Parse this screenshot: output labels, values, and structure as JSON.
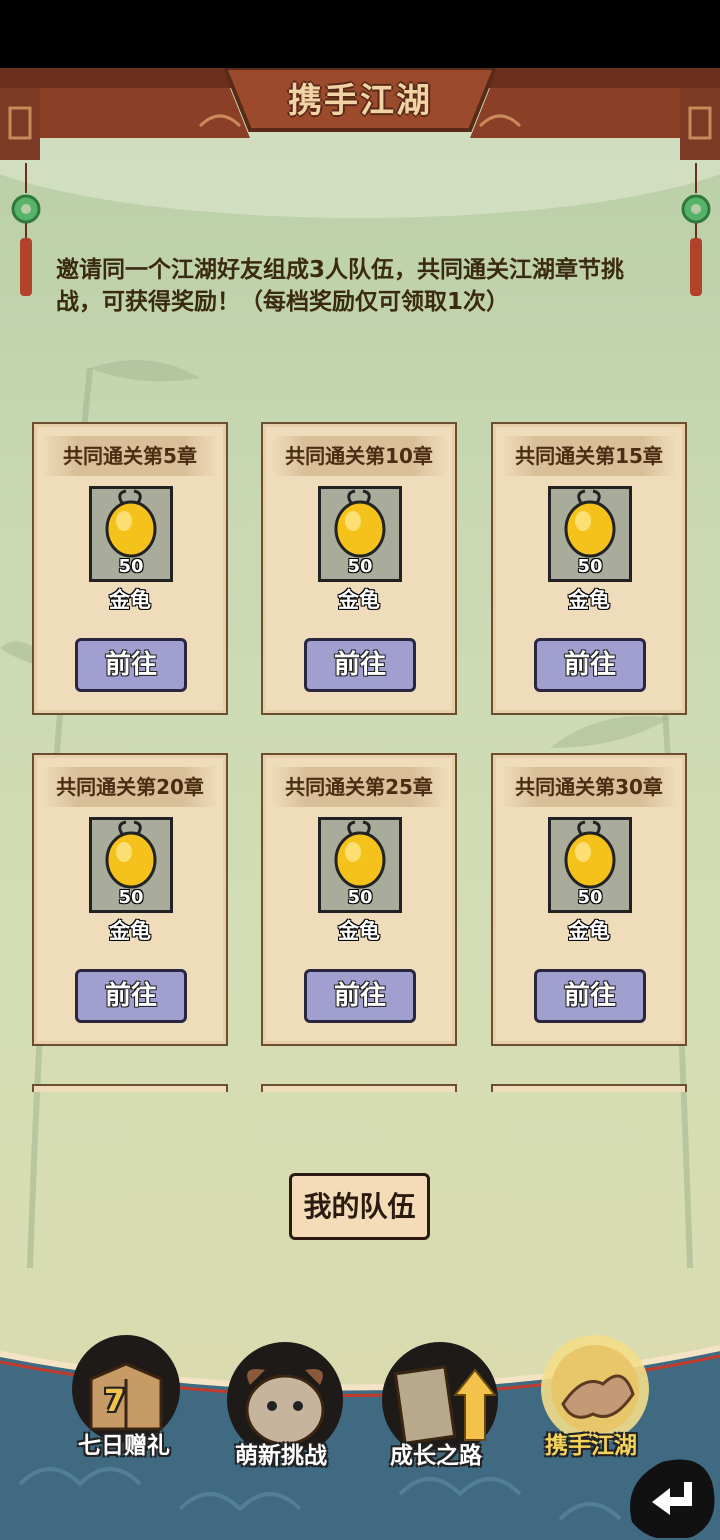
{
  "header": {
    "title": "携手江湖"
  },
  "description": "邀请同一个江湖好友组成3人队伍，共同通关江湖章节挑战，可获得奖励！（每档奖励仅可领取1次）",
  "rewards": [
    {
      "title": "共同通关第5章",
      "item": "金龟",
      "qty": "50",
      "button": "前往"
    },
    {
      "title": "共同通关第10章",
      "item": "金龟",
      "qty": "50",
      "button": "前往"
    },
    {
      "title": "共同通关第15章",
      "item": "金龟",
      "qty": "50",
      "button": "前往"
    },
    {
      "title": "共同通关第20章",
      "item": "金龟",
      "qty": "50",
      "button": "前往"
    },
    {
      "title": "共同通关第25章",
      "item": "金龟",
      "qty": "50",
      "button": "前往"
    },
    {
      "title": "共同通关第30章",
      "item": "金龟",
      "qty": "50",
      "button": "前往"
    }
  ],
  "team_button": "我的队伍",
  "tabs": [
    {
      "label": "七日赠礼",
      "badge": "7",
      "icon": "gift-box-icon"
    },
    {
      "label": "萌新挑战",
      "icon": "pig-face-icon"
    },
    {
      "label": "成长之路",
      "icon": "book-arrow-icon"
    },
    {
      "label": "携手江湖",
      "icon": "handshake-icon",
      "active": true
    }
  ],
  "colors": {
    "button_purple": "#a19ed0",
    "card_bg": "#efdcbb",
    "active_tab": "#f6d35a",
    "banner_wood": "#8a3f26"
  }
}
